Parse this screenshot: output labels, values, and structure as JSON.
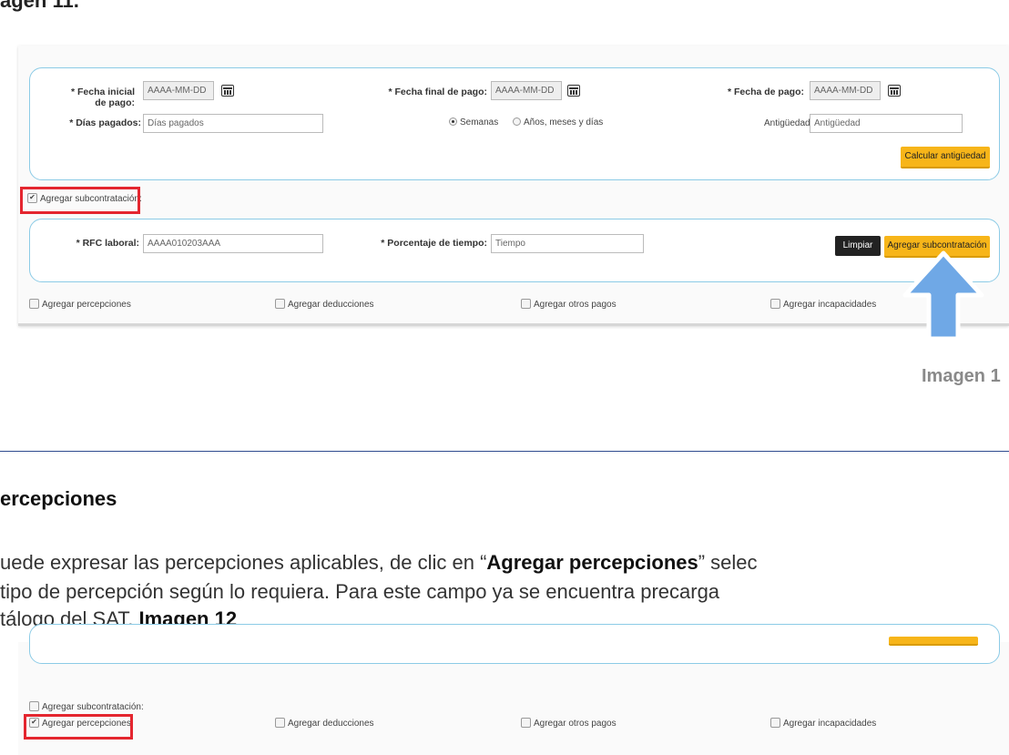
{
  "top_heading": "agen 11.",
  "form": {
    "fecha_inicial_label": "* Fecha inicial de pago:",
    "fecha_inicial_placeholder": "AAAA-MM-DD",
    "fecha_final_label": "* Fecha final de pago:",
    "fecha_final_placeholder": "AAAA-MM-DD",
    "fecha_pago_label": "* Fecha de pago:",
    "fecha_pago_placeholder": "AAAA-MM-DD",
    "dias_label": "* Días pagados:",
    "dias_placeholder": "Días pagados",
    "radio_semanas": "Semanas",
    "radio_anos": "Años, meses y días",
    "antiguedad_label": "Antigüedad:",
    "antiguedad_placeholder": "Antigüedad",
    "calcular_button": "Calcular antigüedad",
    "sub_checkbox": "Agregar subcontratación:",
    "rfc_label": "* RFC laboral:",
    "rfc_value": "AAAA010203AAA",
    "porcentaje_label": "* Porcentaje de tiempo:",
    "porcentaje_placeholder": "Tiempo",
    "limpiar_button": "Limpiar",
    "agregar_sub_button": "Agregar subcontratación",
    "percepciones": "Agregar percepciones",
    "deducciones": "Agregar deducciones",
    "otros_pagos": "Agregar otros pagos",
    "incapacidades": "Agregar incapacidades"
  },
  "caption": "Imagen 1",
  "section": {
    "heading": "ercepciones",
    "line1_a": "uede expresar las percepciones aplicables, de clic en “",
    "line1_b": "Agregar percepciones",
    "line1_c": "”  selec",
    "line2": " tipo de percepción según lo requiera. Para este campo ya se encuentra precarga",
    "line3_a": "tálogo del SAT. ",
    "line3_b": "Imagen 12"
  },
  "form2": {
    "sub_checkbox": "Agregar subcontratación:",
    "percepciones": "Agregar percepciones",
    "deducciones": "Agregar deducciones",
    "otros_pagos": "Agregar otros pagos",
    "incapacidades": "Agregar incapacidades"
  },
  "colors": {
    "accent_yellow": "#f7b519",
    "highlight_red": "#e4262f",
    "arrow_blue": "#6fa8e6",
    "panel_border": "#8ccbe6"
  }
}
